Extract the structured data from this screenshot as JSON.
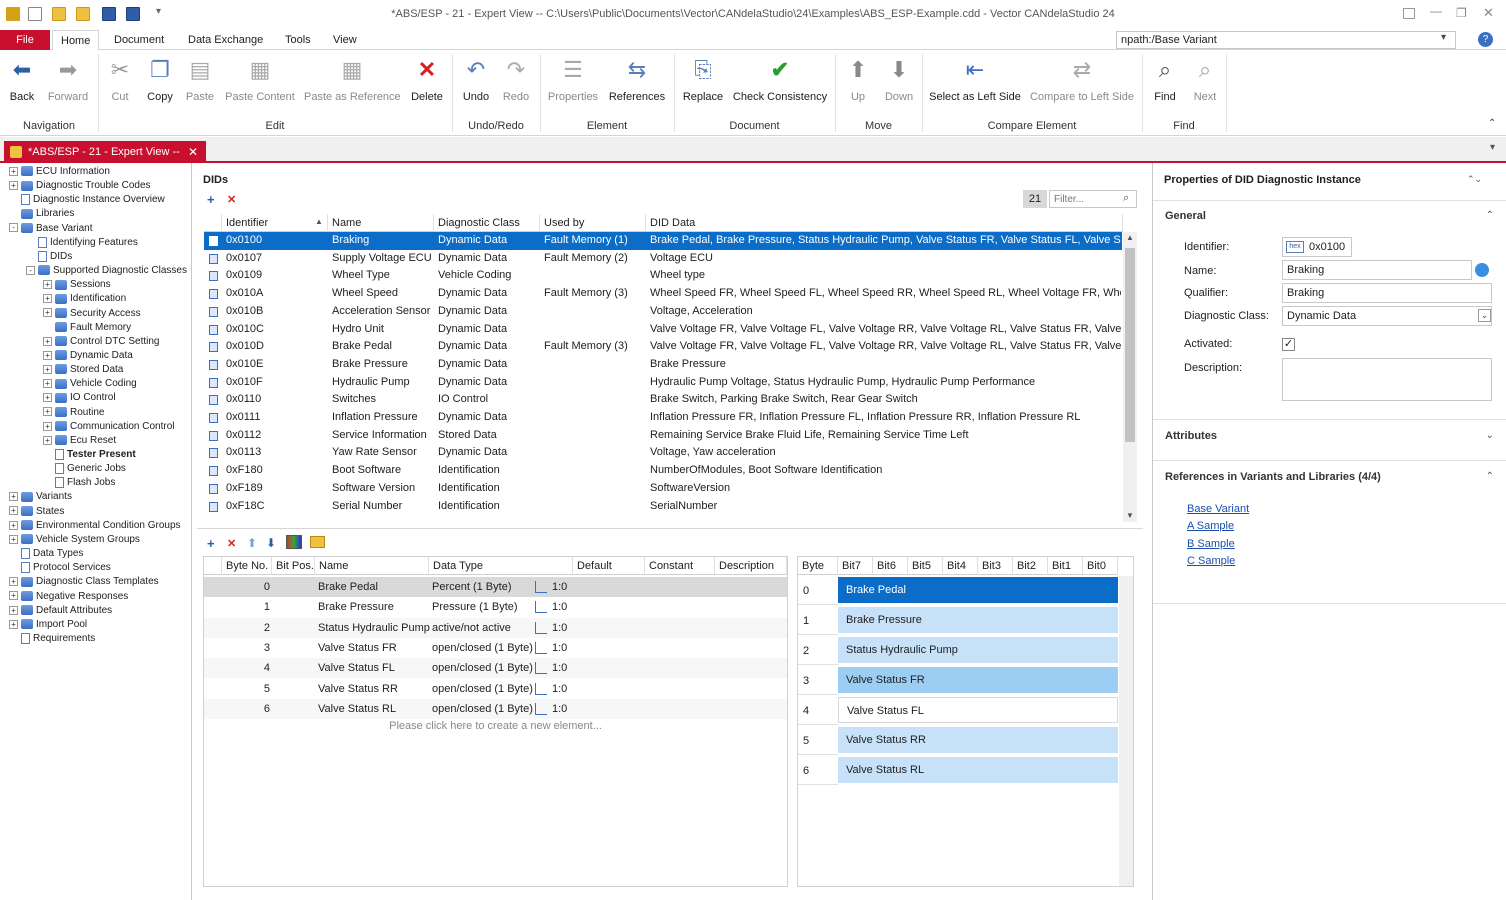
{
  "window": {
    "title": "*ABS/ESP - 21 - Expert View -- C:\\Users\\Public\\Documents\\Vector\\CANdelaStudio\\24\\Examples\\ABS_ESP-Example.cdd - Vector CANdelaStudio 24"
  },
  "menu": {
    "file": "File",
    "tabs": [
      "Home",
      "Document",
      "Data Exchange",
      "Tools",
      "View"
    ],
    "npath_value": "npath:/Base Variant"
  },
  "ribbon": {
    "buttons": [
      {
        "label": "Back",
        "icon": "arrow-left-icon"
      },
      {
        "label": "Forward",
        "icon": "arrow-right-icon"
      },
      {
        "label": "Cut",
        "icon": "scissors-icon"
      },
      {
        "label": "Copy",
        "icon": "copy-icon"
      },
      {
        "label": "Paste",
        "icon": "paste-icon"
      },
      {
        "label": "Paste Content",
        "icon": "paste-content-icon"
      },
      {
        "label": "Paste as Reference",
        "icon": "paste-reference-icon"
      },
      {
        "label": "Delete",
        "icon": "delete-x-icon"
      },
      {
        "label": "Undo",
        "icon": "undo-icon"
      },
      {
        "label": "Redo",
        "icon": "redo-icon"
      },
      {
        "label": "Properties",
        "icon": "properties-icon"
      },
      {
        "label": "References",
        "icon": "references-icon"
      },
      {
        "label": "Replace",
        "icon": "replace-icon"
      },
      {
        "label": "Check Consistency",
        "icon": "check-consistency-icon"
      },
      {
        "label": "Up",
        "icon": "arrow-up-icon"
      },
      {
        "label": "Down",
        "icon": "arrow-down-icon"
      },
      {
        "label": "Select as Left Side",
        "icon": "select-left-icon"
      },
      {
        "label": "Compare to Left Side",
        "icon": "compare-icon"
      },
      {
        "label": "Find",
        "icon": "binoculars-icon"
      },
      {
        "label": "Next",
        "icon": "find-next-icon"
      }
    ],
    "groups": [
      "Navigation",
      "Edit",
      "Undo/Redo",
      "Element",
      "Document",
      "Move",
      "Compare Element",
      "Find"
    ]
  },
  "doc_tab": "*ABS/ESP - 21 - Expert View --",
  "tree": [
    {
      "label": "ECU Information",
      "lvl": 0,
      "exp": "+",
      "ico": "blue"
    },
    {
      "label": "Diagnostic Trouble Codes",
      "lvl": 0,
      "exp": "+",
      "ico": "blue"
    },
    {
      "label": "Diagnostic Instance Overview",
      "lvl": 0,
      "exp": "",
      "ico": "doc"
    },
    {
      "label": "Libraries",
      "lvl": 0,
      "exp": "",
      "ico": "blue"
    },
    {
      "label": "Base Variant",
      "lvl": 0,
      "exp": "-",
      "ico": "blue"
    },
    {
      "label": "Identifying Features",
      "lvl": 1,
      "exp": "",
      "ico": "doc"
    },
    {
      "label": "DIDs",
      "lvl": 1,
      "exp": "",
      "ico": "doc"
    },
    {
      "label": "Supported Diagnostic Classes",
      "lvl": 1,
      "exp": "-",
      "ico": "blue"
    },
    {
      "label": "Sessions",
      "lvl": 2,
      "exp": "+",
      "ico": "blue"
    },
    {
      "label": "Identification",
      "lvl": 2,
      "exp": "+",
      "ico": "blue"
    },
    {
      "label": "Security Access",
      "lvl": 2,
      "exp": "+",
      "ico": "blue"
    },
    {
      "label": "Fault Memory",
      "lvl": 2,
      "exp": "",
      "ico": "blue"
    },
    {
      "label": "Control DTC Setting",
      "lvl": 2,
      "exp": "+",
      "ico": "blue"
    },
    {
      "label": "Dynamic Data",
      "lvl": 2,
      "exp": "+",
      "ico": "blue"
    },
    {
      "label": "Stored Data",
      "lvl": 2,
      "exp": "+",
      "ico": "blue"
    },
    {
      "label": "Vehicle Coding",
      "lvl": 2,
      "exp": "+",
      "ico": "blue"
    },
    {
      "label": "IO Control",
      "lvl": 2,
      "exp": "+",
      "ico": "blue"
    },
    {
      "label": "Routine",
      "lvl": 2,
      "exp": "+",
      "ico": "blue"
    },
    {
      "label": "Communication Control",
      "lvl": 2,
      "exp": "+",
      "ico": "blue"
    },
    {
      "label": "Ecu Reset",
      "lvl": 2,
      "exp": "+",
      "ico": "blue"
    },
    {
      "label": "Tester Present",
      "lvl": 2,
      "exp": "",
      "ico": "doc",
      "bold": true
    },
    {
      "label": "Generic Jobs",
      "lvl": 2,
      "exp": "",
      "ico": "doc"
    },
    {
      "label": "Flash Jobs",
      "lvl": 2,
      "exp": "",
      "ico": "doc"
    },
    {
      "label": "Variants",
      "lvl": 0,
      "exp": "+",
      "ico": "blue"
    },
    {
      "label": "States",
      "lvl": 0,
      "exp": "+",
      "ico": "blue"
    },
    {
      "label": "Environmental Condition Groups",
      "lvl": 0,
      "exp": "+",
      "ico": "blue"
    },
    {
      "label": "Vehicle System Groups",
      "lvl": 0,
      "exp": "+",
      "ico": "blue"
    },
    {
      "label": "Data Types",
      "lvl": 0,
      "exp": "",
      "ico": "doc"
    },
    {
      "label": "Protocol Services",
      "lvl": 0,
      "exp": "",
      "ico": "doc"
    },
    {
      "label": "Diagnostic Class Templates",
      "lvl": 0,
      "exp": "+",
      "ico": "blue"
    },
    {
      "label": "Negative Responses",
      "lvl": 0,
      "exp": "+",
      "ico": "blue"
    },
    {
      "label": "Default Attributes",
      "lvl": 0,
      "exp": "+",
      "ico": "blue"
    },
    {
      "label": "Import Pool",
      "lvl": 0,
      "exp": "+",
      "ico": "blue"
    },
    {
      "label": "Requirements",
      "lvl": 0,
      "exp": "",
      "ico": "doc"
    }
  ],
  "dids": {
    "title": "DIDs",
    "count": "21",
    "filter_placeholder": "Filter...",
    "columns": [
      "Identifier",
      "Name",
      "Diagnostic Class",
      "Used by",
      "DID Data"
    ],
    "rows": [
      [
        "0x0100",
        "Braking",
        "Dynamic Data",
        "Fault Memory (1)",
        "Brake Pedal, Brake Pressure, Status Hydraulic Pump, Valve Status FR, Valve Status FL, Valve Statu..."
      ],
      [
        "0x0107",
        "Supply Voltage ECU",
        "Dynamic Data",
        "Fault Memory (2)",
        "Voltage ECU"
      ],
      [
        "0x0109",
        "Wheel Type",
        "Vehicle Coding",
        "",
        "Wheel type"
      ],
      [
        "0x010A",
        "Wheel Speed",
        "Dynamic Data",
        "Fault Memory (3)",
        "Wheel Speed FR, Wheel Speed FL, Wheel Speed RR, Wheel Speed RL, Wheel Voltage FR, Wheel V..."
      ],
      [
        "0x010B",
        "Acceleration Sensor",
        "Dynamic Data",
        "",
        "Voltage, Acceleration"
      ],
      [
        "0x010C",
        "Hydro Unit",
        "Dynamic Data",
        "",
        "Valve Voltage FR, Valve Voltage FL, Valve Voltage RR, Valve Voltage RL, Valve Status FR, Valve St..."
      ],
      [
        "0x010D",
        "Brake Pedal",
        "Dynamic Data",
        "Fault Memory (3)",
        "Valve Voltage FR, Valve Voltage FL, Valve Voltage RR, Valve Voltage RL, Valve Status FR, Valve St..."
      ],
      [
        "0x010E",
        "Brake Pressure",
        "Dynamic Data",
        "",
        "Brake Pressure"
      ],
      [
        "0x010F",
        "Hydraulic Pump",
        "Dynamic Data",
        "",
        "Hydraulic Pump Voltage, Status Hydraulic Pump, Hydraulic Pump Performance"
      ],
      [
        "0x0110",
        "Switches",
        "IO Control",
        "",
        "Brake Switch, Parking Brake Switch, Rear Gear Switch"
      ],
      [
        "0x0111",
        "Inflation Pressure",
        "Dynamic Data",
        "",
        "Inflation Pressure FR, Inflation Pressure FL, Inflation Pressure RR, Inflation Pressure RL"
      ],
      [
        "0x0112",
        "Service Information",
        "Stored Data",
        "",
        "Remaining Service Brake Fluid Life, Remaining Service Time Left"
      ],
      [
        "0x0113",
        "Yaw Rate Sensor",
        "Dynamic Data",
        "",
        "Voltage, Yaw acceleration"
      ],
      [
        "0xF180",
        "Boot Software",
        "Identification",
        "",
        "NumberOfModules, Boot Software Identification"
      ],
      [
        "0xF189",
        "Software Version",
        "Identification",
        "",
        "SoftwareVersion"
      ],
      [
        "0xF18C",
        "Serial Number",
        "Identification",
        "",
        "SerialNumber"
      ]
    ]
  },
  "bytes": {
    "columns": [
      "Byte No.",
      "Bit Pos.",
      "Name",
      "Data Type",
      "Default",
      "Constant",
      "Description"
    ],
    "rows": [
      [
        "0",
        "",
        "Brake Pedal",
        "Percent (1 Byte)",
        "1:0"
      ],
      [
        "1",
        "",
        "Brake Pressure",
        "Pressure (1 Byte)",
        "1:0"
      ],
      [
        "2",
        "",
        "Status Hydraulic Pump",
        "active/not active",
        "1:0"
      ],
      [
        "3",
        "",
        "Valve Status FR",
        "open/closed (1 Byte)",
        "1:0"
      ],
      [
        "4",
        "",
        "Valve Status FL",
        "open/closed (1 Byte)",
        "1:0"
      ],
      [
        "5",
        "",
        "Valve Status RR",
        "open/closed (1 Byte)",
        "1:0"
      ],
      [
        "6",
        "",
        "Valve Status RL",
        "open/closed (1 Byte)",
        "1:0"
      ]
    ],
    "new_element": "Please click here to create a new element..."
  },
  "bits": {
    "columns": [
      "Byte",
      "Bit7",
      "Bit6",
      "Bit5",
      "Bit4",
      "Bit3",
      "Bit2",
      "Bit1",
      "Bit0"
    ],
    "rows": [
      [
        "0",
        "Brake Pedal"
      ],
      [
        "1",
        "Brake Pressure"
      ],
      [
        "2",
        "Status Hydraulic Pump"
      ],
      [
        "3",
        "Valve Status FR"
      ],
      [
        "4",
        "Valve Status FL"
      ],
      [
        "5",
        "Valve Status RR"
      ],
      [
        "6",
        "Valve Status RL"
      ]
    ]
  },
  "properties": {
    "title": "Properties of DID Diagnostic Instance",
    "general": "General",
    "identifier_label": "Identifier:",
    "hex_tag": "hex",
    "identifier_value": "0x0100",
    "name_label": "Name:",
    "name_value": "Braking",
    "qualifier_label": "Qualifier:",
    "qualifier_value": "Braking",
    "class_label": "Diagnostic Class:",
    "class_value": "Dynamic Data",
    "activated_label": "Activated:",
    "description_label": "Description:",
    "attributes": "Attributes",
    "references": "References in Variants and Libraries (4/4)",
    "links": [
      "Base Variant",
      "A Sample",
      "B Sample",
      "C Sample"
    ]
  },
  "colors": {
    "accent": "#c8102e",
    "selection": "#0b6dc8",
    "bitfield": "#c6e1f8"
  }
}
